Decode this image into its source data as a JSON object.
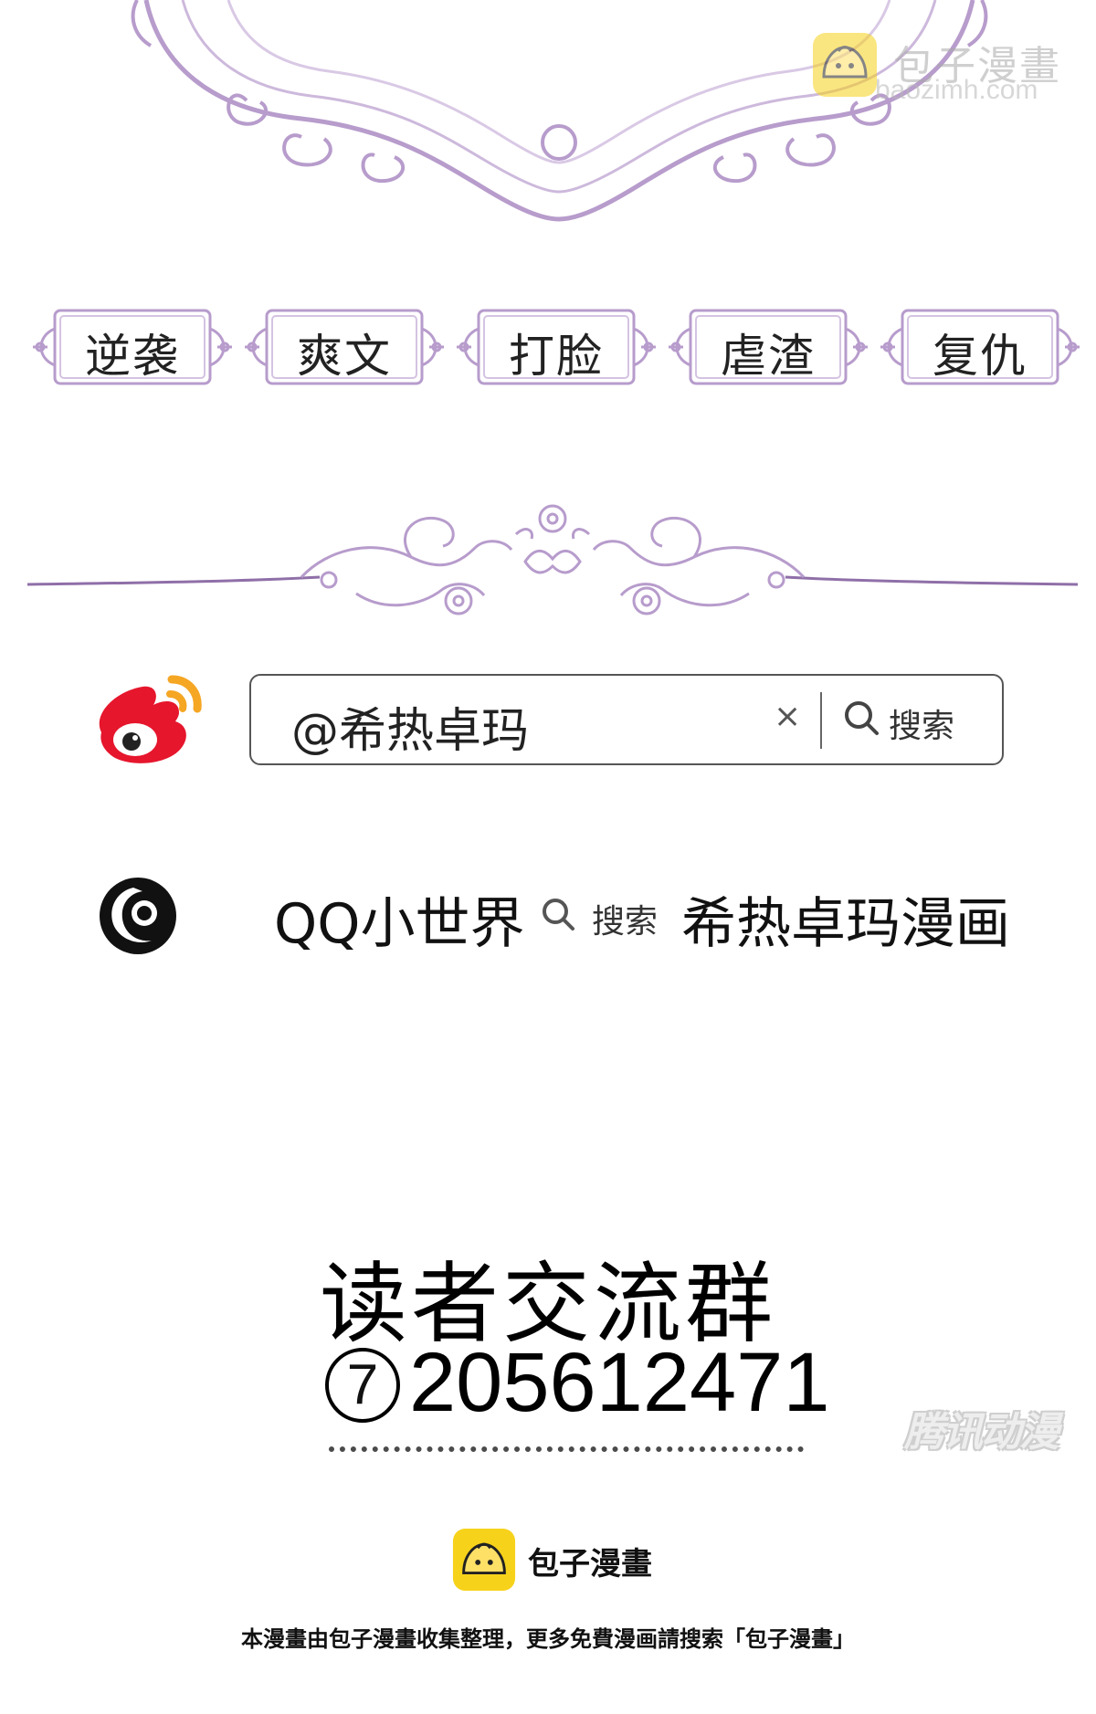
{
  "watermark": {
    "brand": "包子漫畫",
    "url": "baozimh.com"
  },
  "tags": [
    {
      "label": "逆袭"
    },
    {
      "label": "爽文"
    },
    {
      "label": "打脸"
    },
    {
      "label": "虐渣"
    },
    {
      "label": "复仇"
    }
  ],
  "weibo": {
    "icon": "weibo-icon",
    "search_value": "@希热卓玛",
    "clear_glyph": "×",
    "search_label": "搜索"
  },
  "qq": {
    "icon": "qq-channel-icon",
    "title": "QQ小世界",
    "search_label": "搜索",
    "query": "希热卓玛漫画"
  },
  "reader_group": {
    "title": "读者交流群",
    "number_prefix": "7",
    "number": "205612471"
  },
  "tencent_watermark": "腾讯动漫",
  "footer": {
    "brand": "包子漫畫",
    "note": "本漫畫由包子漫畫收集整理，更多免費漫画請搜索「包子漫畫」"
  },
  "colors": {
    "ornament": "#b79ccc",
    "ornament_dark": "#8f6fa8",
    "logo_yellow": "#f7d21a",
    "weibo_red": "#e6162d",
    "weibo_orange": "#f5a623"
  }
}
